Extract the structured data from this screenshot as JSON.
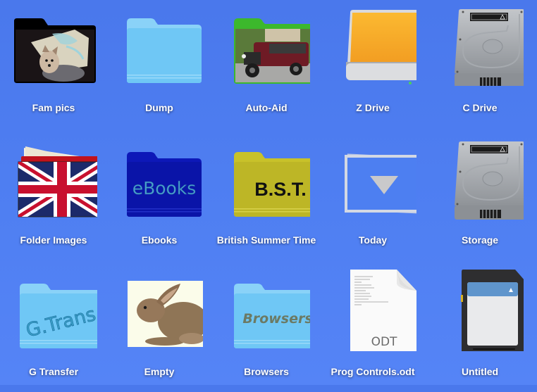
{
  "desktop": {
    "background_color": "#4f7ff2",
    "items": [
      {
        "label": "Fam pics",
        "icon": "folder-photo-dog-icon",
        "kind": "folder"
      },
      {
        "label": "Dump",
        "icon": "folder-icon",
        "kind": "folder"
      },
      {
        "label": "Auto-Aid",
        "icon": "folder-photo-car-icon",
        "kind": "folder"
      },
      {
        "label": "Z Drive",
        "icon": "external-drive-icon",
        "kind": "drive"
      },
      {
        "label": "C Drive",
        "icon": "hard-disk-icon",
        "kind": "drive"
      },
      {
        "label": "Folder Images",
        "icon": "union-jack-folder-icon",
        "kind": "folder"
      },
      {
        "label": "Ebooks",
        "icon": "folder-ebooks-icon",
        "kind": "folder",
        "badge_text": "eBooks"
      },
      {
        "label": "British Summer Time",
        "icon": "folder-bst-icon",
        "kind": "folder",
        "badge_text": "B.S.T."
      },
      {
        "label": "Today",
        "icon": "stack-down-arrow-icon",
        "kind": "stack"
      },
      {
        "label": "Storage",
        "icon": "hard-disk-icon",
        "kind": "drive"
      },
      {
        "label": "G Transfer",
        "icon": "folder-gtrans-icon",
        "kind": "folder",
        "badge_text": "G.Trans"
      },
      {
        "label": "Empty",
        "icon": "rabbit-image-icon",
        "kind": "folder"
      },
      {
        "label": "Browsers",
        "icon": "folder-browsers-icon",
        "kind": "folder",
        "badge_text": "Browsers"
      },
      {
        "label": "Prog Controls.odt",
        "icon": "odt-document-icon",
        "kind": "file",
        "badge_text": "ODT"
      },
      {
        "label": "Untitled",
        "icon": "sd-card-icon",
        "kind": "drive"
      }
    ]
  }
}
